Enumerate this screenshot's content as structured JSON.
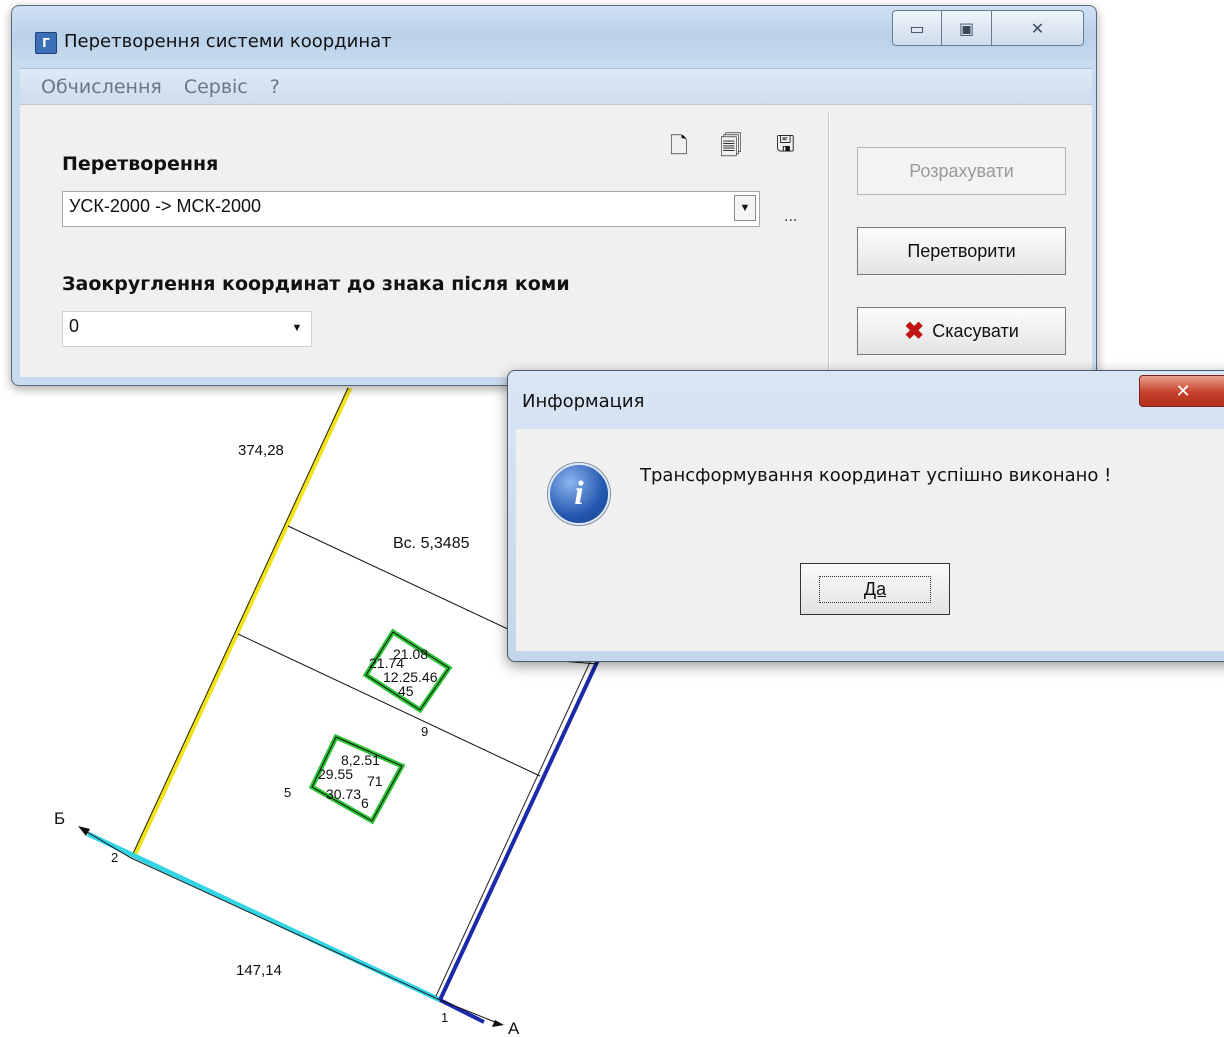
{
  "main_window": {
    "title": "Перетворення системи координат",
    "menu": [
      "Обчислення",
      "Сервіс",
      "?"
    ],
    "transform_label": "Перетворення",
    "transform_value": "УСК-2000 -> МСК-2000",
    "more_button": "...",
    "rounding_label": "Заокруглення координат до знака після коми",
    "rounding_value": "0",
    "buttons": {
      "calculate": "Розрахувати",
      "convert": "Перетворити",
      "cancel": "Скасувати"
    }
  },
  "dialog": {
    "title": "Информация",
    "message": "Трансформування координат успішно виконано !",
    "ok_button": "Да"
  },
  "drawing": {
    "labels": {
      "len_left": "374,28",
      "len_bottom": "147,14",
      "area": "Вс. 5,3485",
      "pt1": "1",
      "pt2": "2",
      "pt5": "5",
      "pt9": "9",
      "dir_b": "Б",
      "dir_a": "А",
      "bld1_a": "21.08",
      "bld1_b": "21.74",
      "bld1_c": "12.25.46",
      "bld1_d": "45",
      "bld2_a": "8,2.51",
      "bld2_b": "29.55",
      "bld2_c": "30.73",
      "bld2_d": "71",
      "bld2_e": "6"
    },
    "colors": {
      "yellow": "#f2e21a",
      "cyan": "#33d4e6",
      "blue": "#1b2aa8",
      "green": "#2fc435",
      "black": "#111111"
    }
  }
}
